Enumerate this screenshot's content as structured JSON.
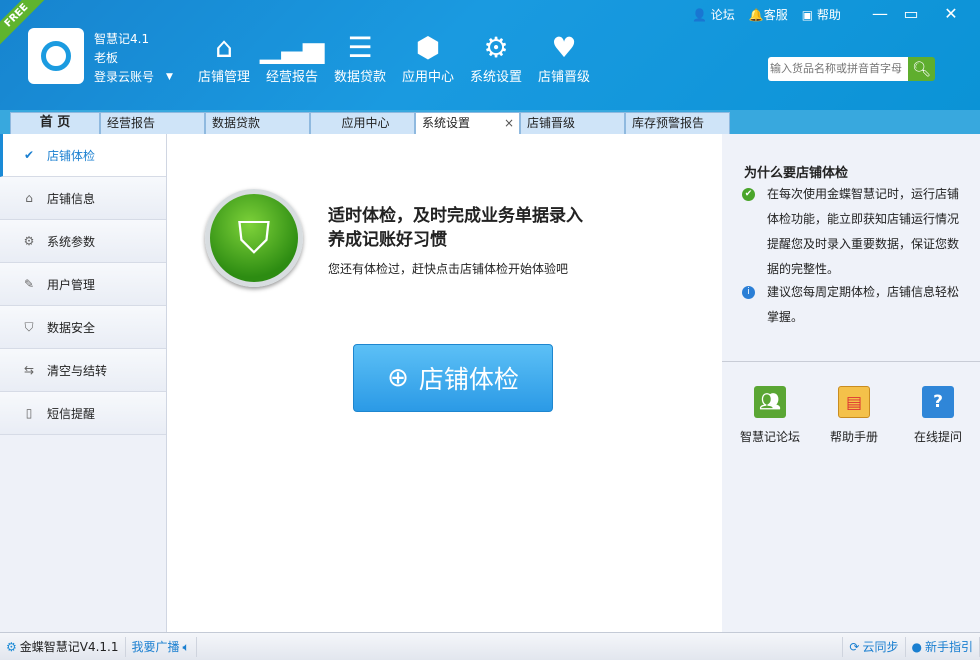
{
  "header": {
    "badge": "FREE",
    "app_version": "智慧记4.1",
    "user": "老板",
    "login": "登录云账号",
    "nav": [
      {
        "label": "店铺管理",
        "icon": "home-icon"
      },
      {
        "label": "经营报告",
        "icon": "bar-chart-icon"
      },
      {
        "label": "数据贷款",
        "icon": "money-stack-icon"
      },
      {
        "label": "应用中心",
        "icon": "app-center-icon"
      },
      {
        "label": "系统设置",
        "icon": "gear-icon"
      },
      {
        "label": "店铺晋级",
        "icon": "hearts-icon"
      }
    ],
    "links": [
      "论坛",
      "客服",
      "帮助"
    ],
    "search_placeholder": "输入货品名称或拼音首字母"
  },
  "tabs": [
    "首 页",
    "经营报告",
    "数据贷款",
    "应用中心",
    "系统设置",
    "店铺晋级",
    "库存预警报告"
  ],
  "sidebar": [
    "店铺体检",
    "店铺信息",
    "系统参数",
    "用户管理",
    "数据安全",
    "清空与结转",
    "短信提醒"
  ],
  "main": {
    "headline1": "适时体检，及时完成业务单据录入",
    "headline2": "养成记账好习惯",
    "subtitle": "您还有体检过，赶快点击店铺体检开始体验吧",
    "button": "店铺体检"
  },
  "right": {
    "title": "为什么要店铺体检",
    "tip1": "在每次使用金蝶智慧记时，运行店铺体检功能，能立即获知店铺运行情况提醒您及时录入重要数据，保证您数据的完整性。",
    "tip2": "建议您每周定期体检，店铺信息轻松掌握。",
    "tools": [
      "智慧记论坛",
      "帮助手册",
      "在线提问"
    ]
  },
  "status": {
    "version": "金蝶智慧记V4.1.1",
    "broadcast": "我要广播",
    "sync": "云同步",
    "guide": "新手指引"
  }
}
